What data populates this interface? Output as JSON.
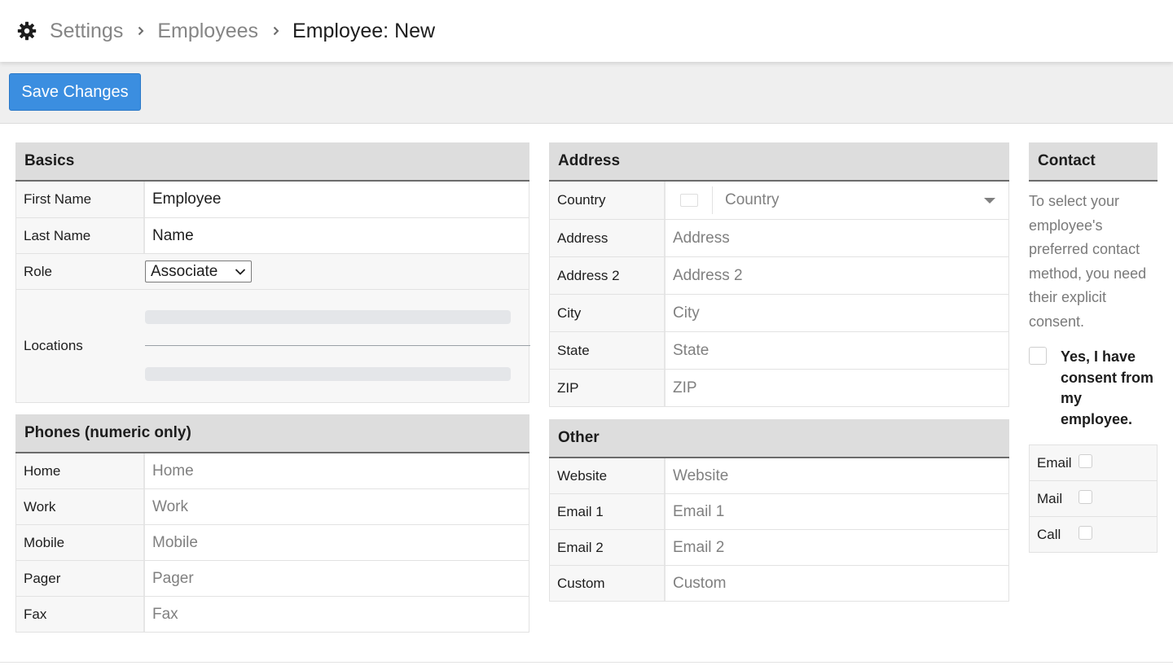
{
  "breadcrumb": {
    "items": [
      "Settings",
      "Employees"
    ],
    "current": "Employee: New"
  },
  "toolbar": {
    "save_label": "Save Changes"
  },
  "basics": {
    "title": "Basics",
    "first_name": {
      "label": "First Name",
      "value": "Employee"
    },
    "last_name": {
      "label": "Last Name",
      "value": "Name"
    },
    "role": {
      "label": "Role",
      "value": "Associate"
    },
    "locations": {
      "label": "Locations"
    }
  },
  "phones": {
    "title": "Phones (numeric only)",
    "fields": [
      {
        "label": "Home",
        "placeholder": "Home"
      },
      {
        "label": "Work",
        "placeholder": "Work"
      },
      {
        "label": "Mobile",
        "placeholder": "Mobile"
      },
      {
        "label": "Pager",
        "placeholder": "Pager"
      },
      {
        "label": "Fax",
        "placeholder": "Fax"
      }
    ]
  },
  "address": {
    "title": "Address",
    "country": {
      "label": "Country",
      "placeholder": "Country"
    },
    "fields": [
      {
        "label": "Address",
        "placeholder": "Address"
      },
      {
        "label": "Address 2",
        "placeholder": "Address 2"
      },
      {
        "label": "City",
        "placeholder": "City"
      },
      {
        "label": "State",
        "placeholder": "State"
      },
      {
        "label": "ZIP",
        "placeholder": "ZIP"
      }
    ]
  },
  "other": {
    "title": "Other",
    "fields": [
      {
        "label": "Website",
        "placeholder": "Website"
      },
      {
        "label": "Email 1",
        "placeholder": "Email 1"
      },
      {
        "label": "Email 2",
        "placeholder": "Email 2"
      },
      {
        "label": "Custom",
        "placeholder": "Custom"
      }
    ]
  },
  "contact": {
    "title": "Contact",
    "note": "To select your employee's preferred contact method, you need their explicit consent.",
    "consent_label": "Yes, I have consent from my employee.",
    "methods": [
      "Email",
      "Mail",
      "Call"
    ]
  },
  "colors": {
    "accent": "#3b8ee0",
    "panel_header": "#dddddd",
    "muted_text": "#858585"
  }
}
